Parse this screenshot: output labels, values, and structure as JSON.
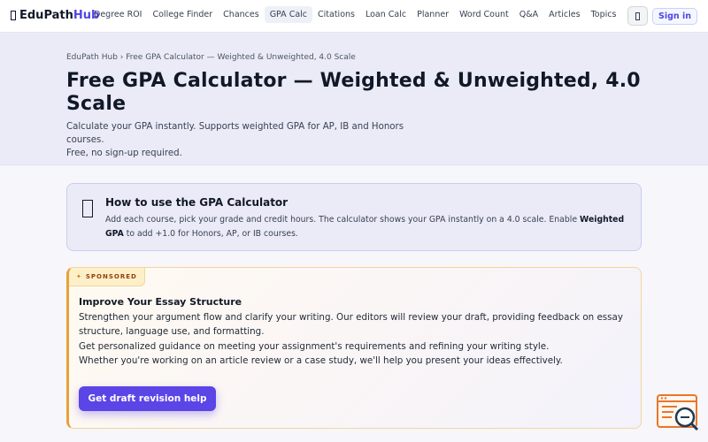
{
  "brand": {
    "name_part1": "EduPath",
    "name_part2": "Hub"
  },
  "nav": {
    "items": [
      {
        "label": "Degree ROI",
        "active": false
      },
      {
        "label": "College Finder",
        "active": false
      },
      {
        "label": "Chances",
        "active": false
      },
      {
        "label": "GPA Calc",
        "active": true
      },
      {
        "label": "Citations",
        "active": false
      },
      {
        "label": "Loan Calc",
        "active": false
      },
      {
        "label": "Planner",
        "active": false
      },
      {
        "label": "Word Count",
        "active": false
      },
      {
        "label": "Q&A",
        "active": false
      },
      {
        "label": "Articles",
        "active": false
      },
      {
        "label": "Topics",
        "active": false
      }
    ],
    "theme_icon": "theme-toggle-icon",
    "signin_label": "Sign in"
  },
  "hero": {
    "breadcrumb": "EduPath Hub › Free GPA Calculator — Weighted & Unweighted, 4.0 Scale",
    "title": "Free GPA Calculator — Weighted & Unweighted, 4.0 Scale",
    "subtitle_line1": "Calculate your GPA instantly. Supports weighted GPA for AP, IB and Honors courses.",
    "subtitle_line2": "Free, no sign-up required."
  },
  "howto": {
    "icon": "book-icon",
    "title": "How to use the GPA Calculator",
    "text_before": "Add each course, pick your grade and credit hours. The calculator shows your GPA instantly on a 4.0 scale. Enable ",
    "text_bold": "Weighted GPA",
    "text_after": " to add +1.0 for Honors, AP, or IB courses."
  },
  "sponsored": {
    "badge_star": "✦",
    "badge": "SPONSORED",
    "title": "Improve Your Essay Structure",
    "line1": "Strengthen your argument flow and clarify your writing. Our editors will review your draft, providing feedback on essay structure, language use, and formatting.",
    "line2": "Get personalized guidance on meeting your assignment's requirements and refining your writing style.",
    "line3": "Whether you're working on an article review or a case study, we'll help you present your ideas effectively.",
    "cta": "Get draft revision help"
  },
  "colors": {
    "accent": "#4f46e5",
    "cta": "#5b45e6",
    "sponsor_border": "#e8a13a",
    "widget": "#e8762c"
  }
}
